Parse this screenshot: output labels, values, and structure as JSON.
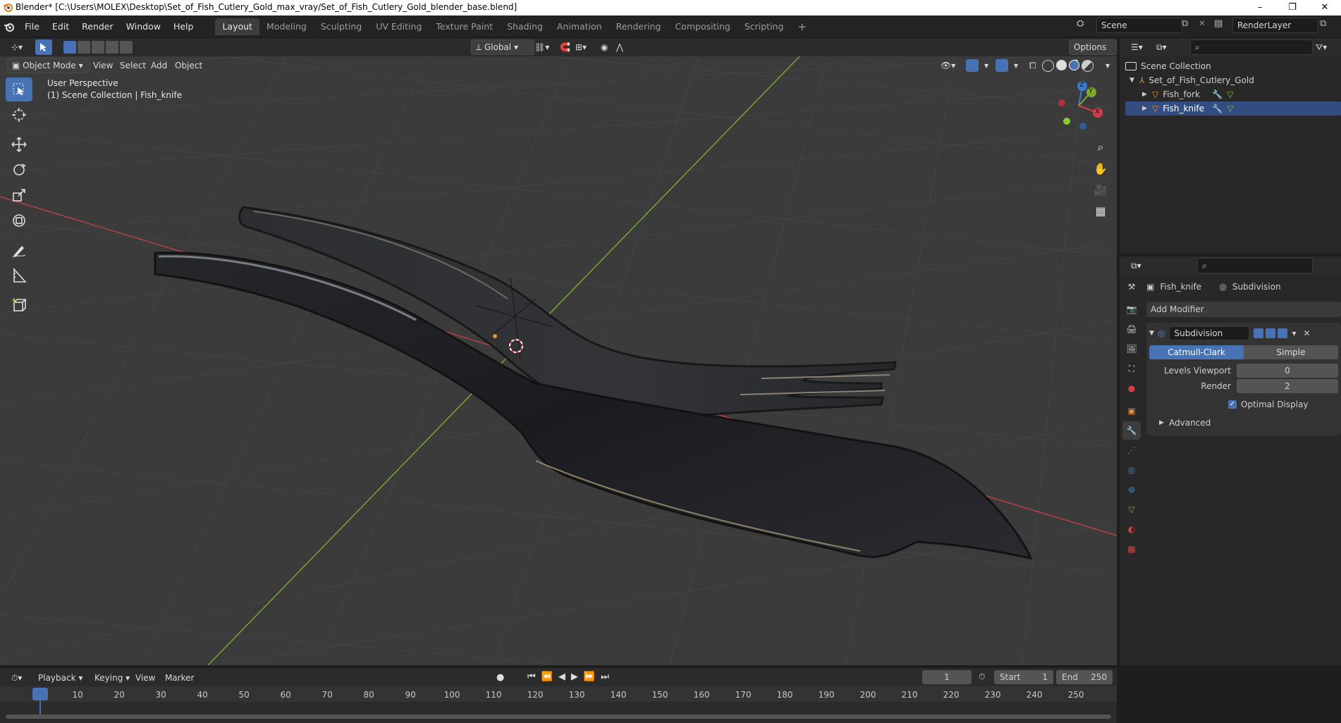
{
  "window": {
    "title": "Blender* [C:\\Users\\MOLEX\\Desktop\\Set_of_Fish_Cutlery_Gold_max_vray/Set_of_Fish_Cutlery_Gold_blender_base.blend]",
    "minimize": "–",
    "restore": "❐",
    "close": "✕"
  },
  "menu": [
    "File",
    "Edit",
    "Render",
    "Window",
    "Help"
  ],
  "workspaces": [
    "Layout",
    "Modeling",
    "Sculpting",
    "UV Editing",
    "Texture Paint",
    "Shading",
    "Animation",
    "Rendering",
    "Compositing",
    "Scripting"
  ],
  "workspace_add": "+",
  "scene": {
    "name": "Scene",
    "render_layer": "RenderLayer"
  },
  "viewport": {
    "orientation": "Global",
    "options": "Options",
    "mode": "Object Mode",
    "menus": [
      "View",
      "Select",
      "Add",
      "Object"
    ],
    "overlay_title": "User Perspective",
    "overlay_sub": "(1) Scene Collection | Fish_knife",
    "gizmo": {
      "x": "X",
      "y": "Y",
      "z": "Z"
    }
  },
  "outliner": {
    "root": "Scene Collection",
    "collection": "Set_of_Fish_Cutlery_Gold",
    "objects": [
      "Fish_fork",
      "Fish_knife"
    ]
  },
  "properties": {
    "object": "Fish_knife",
    "modifier_tab": "Subdivision",
    "add_modifier": "Add Modifier",
    "modifier_name": "Subdivision",
    "type_options": [
      "Catmull-Clark",
      "Simple"
    ],
    "levels_viewport_label": "Levels Viewport",
    "levels_viewport": "0",
    "render_label": "Render",
    "render": "2",
    "optimal_display": "Optimal Display",
    "advanced": "Advanced"
  },
  "timeline": {
    "menus": [
      "Playback",
      "Keying",
      "View",
      "Marker"
    ],
    "current_frame": "1",
    "start_label": "Start",
    "start": "1",
    "end_label": "End",
    "end": "250",
    "ticks": [
      "1",
      "10",
      "20",
      "30",
      "40",
      "50",
      "60",
      "70",
      "80",
      "90",
      "100",
      "110",
      "120",
      "130",
      "140",
      "150",
      "160",
      "170",
      "180",
      "190",
      "200",
      "210",
      "220",
      "230",
      "240",
      "250"
    ]
  },
  "colors": {
    "accent": "#4772b3",
    "x_axis": "#c0404a",
    "y_axis": "#7faa32",
    "object_orange": "#e8913a"
  }
}
